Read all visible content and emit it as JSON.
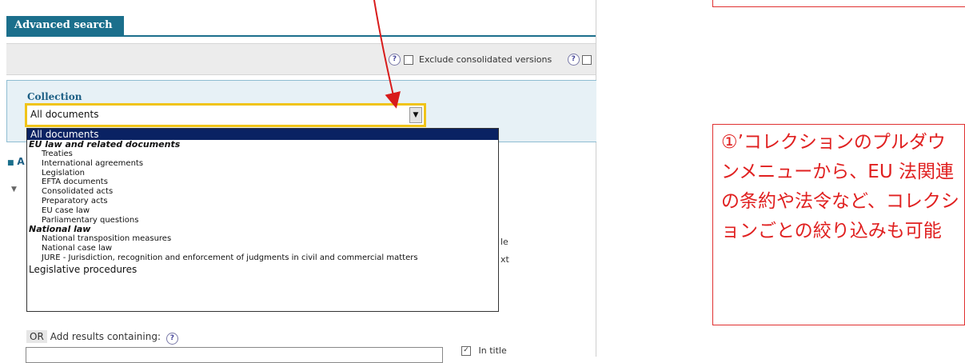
{
  "search_panel": {
    "tab_title": "Advanced search",
    "options": {
      "help_glyph": "?",
      "exclude_consolidated_label": "Exclude consolidated versions"
    },
    "collection": {
      "label": "Collection",
      "selected_value": "All documents"
    },
    "dropdown": {
      "selected": "All documents",
      "groups": [
        {
          "heading": "EU law and related documents",
          "items": [
            "Treaties",
            "International agreements",
            "Legislation",
            "EFTA documents",
            "Consolidated acts",
            "Preparatory acts",
            "EU case law",
            "Parliamentary questions"
          ]
        },
        {
          "heading": "National law",
          "items": [
            "National transposition measures",
            "National case law",
            "JURE - Jurisdiction, recognition and enforcement of judgments in civil and commercial matters"
          ]
        }
      ],
      "last_item": "Legislative procedures"
    },
    "partial_left_marker": "A",
    "partial_right_1": "le",
    "partial_right_2": "xt",
    "add_results": {
      "or_label": "OR",
      "label": "Add results containing:",
      "in_title_label": "In title"
    }
  },
  "annotation": {
    "note_text": "①’コレクションのプルダウンメニューから、EU 法関連の条約や法令など、コレクションごとの絞り込みも可能",
    "color": "#e02020"
  }
}
